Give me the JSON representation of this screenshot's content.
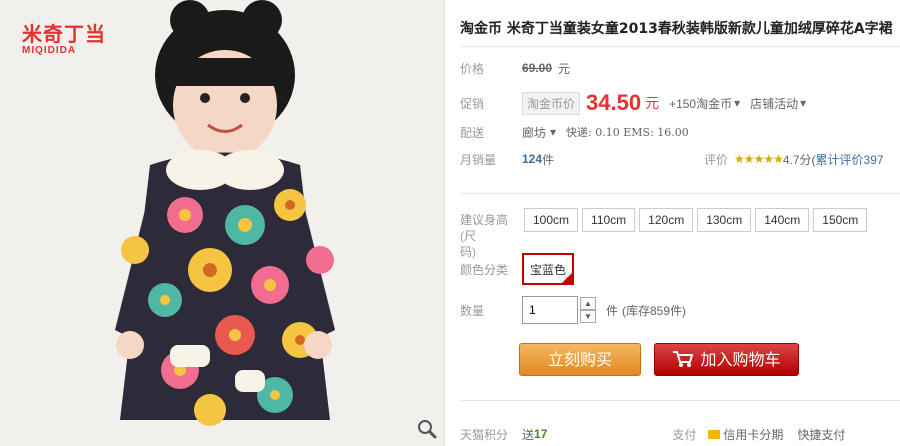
{
  "brand": {
    "logo_cn": "米奇丁当",
    "logo_en": "MIQIDIDA"
  },
  "product": {
    "title": "淘金币 米奇丁当童装女童2013春秋装韩版新款儿童加绒厚碎花A字裙"
  },
  "price": {
    "label": "价格",
    "original": "69.00",
    "unit": "元"
  },
  "promo": {
    "label": "促销",
    "tag": "淘金币价",
    "price": "34.50",
    "unit": "元",
    "coin_bonus": "+150淘金币",
    "store_activity": "店铺活动"
  },
  "shipping": {
    "label": "配送",
    "origin": "廊坊",
    "detail": "快递: 0.10 EMS: 16.00"
  },
  "sales": {
    "label": "月销量",
    "count": "124",
    "unit": "件",
    "rating_label": "评价",
    "stars": "★★★★★",
    "score": "4.7分",
    "rating_link": "(累计评价397"
  },
  "sizes": {
    "label_line1": "建议身高(尺",
    "label_line2": "码)",
    "options": [
      "100cm",
      "110cm",
      "120cm",
      "130cm",
      "140cm",
      "150cm"
    ]
  },
  "color": {
    "label": "颜色分类",
    "selected": "宝蓝色"
  },
  "quantity": {
    "label": "数量",
    "value": "1",
    "unit": "件",
    "stock": "(库存859件)"
  },
  "actions": {
    "buy_now": "立刻购买",
    "add_to_cart": "加入购物车"
  },
  "footer": {
    "label": "天猫积分",
    "bonus_prefix": "送",
    "bonus_value": "17",
    "pay_label": "支付",
    "credit": "信用卡分期",
    "quick_pay": "快捷支付"
  },
  "colors": {
    "accent_red": "#e4322f",
    "buy_orange": "#e08a1f",
    "cart_red": "#b20000"
  }
}
